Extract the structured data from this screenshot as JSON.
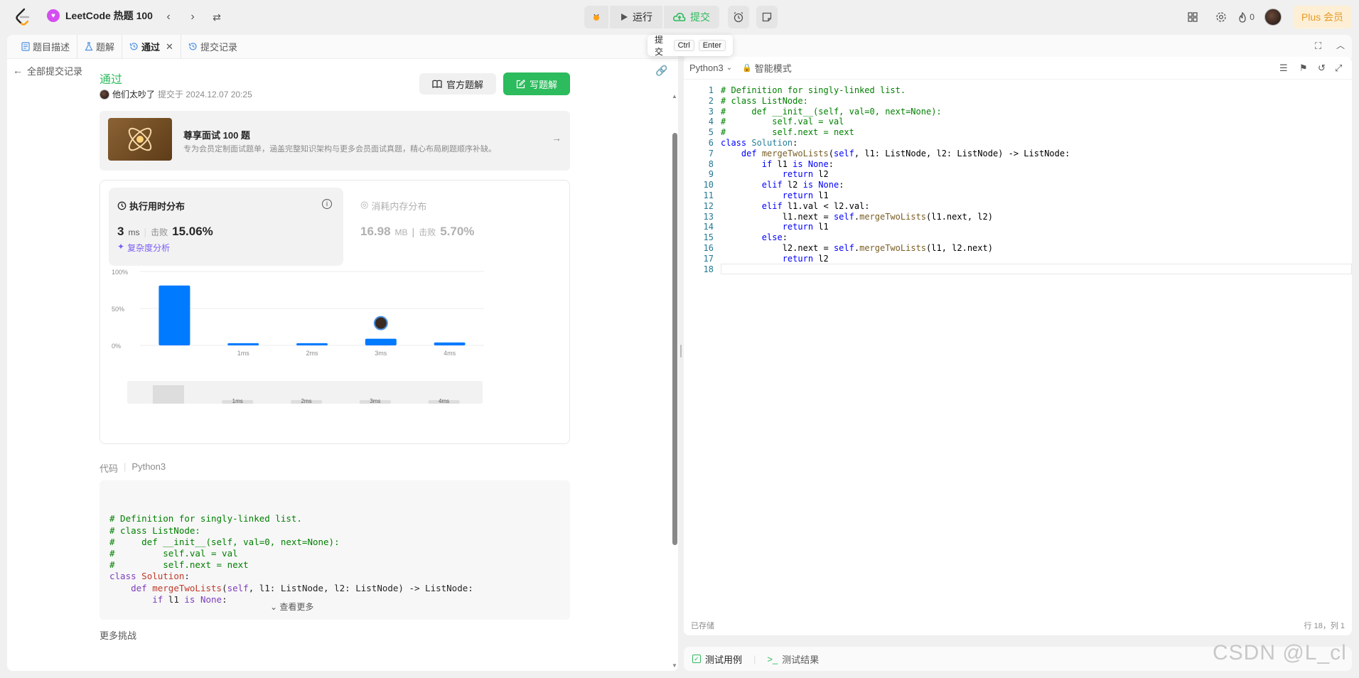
{
  "topbar": {
    "brand": "LeetCode 热题 100",
    "run": "运行",
    "submit": "提交",
    "coins": "0",
    "plus": "Plus 会员"
  },
  "tooltip": {
    "label": "提交",
    "k1": "Ctrl",
    "k2": "Enter"
  },
  "tabs": [
    {
      "label": "题目描述"
    },
    {
      "label": "题解"
    },
    {
      "label": "通过"
    },
    {
      "label": "提交记录"
    }
  ],
  "subheader": {
    "back": "全部提交记录"
  },
  "result": {
    "status": "通过",
    "user": "他们太吵了",
    "submitted": "提交于 2024.12.07 20:25",
    "official": "官方题解",
    "write": "写题解"
  },
  "promo": {
    "title": "尊享面试 100 题",
    "desc": "专为会员定制面试题单，涵盖完整知识架构与更多会员面试真题，精心布局刷题顺序补缺。"
  },
  "runtime": {
    "title": "执行用时分布",
    "value": "3",
    "unit": "ms",
    "beat_label": "击败",
    "beat": "15.06%",
    "complexity": "复杂度分析"
  },
  "memory": {
    "title": "消耗内存分布",
    "value": "16.98",
    "unit": "MB",
    "beat_label": "击败",
    "beat": "5.70%"
  },
  "chart_data": {
    "type": "bar",
    "categories": [
      "",
      "1ms",
      "2ms",
      "3ms",
      "4ms"
    ],
    "values": [
      81,
      3,
      3,
      9,
      4
    ],
    "ylim": [
      0,
      100
    ],
    "yticks": [
      "0%",
      "50%",
      "100%"
    ],
    "highlight": "3ms",
    "color": "#007aff"
  },
  "minimap": {
    "labels": [
      "1ms",
      "2ms",
      "3ms",
      "4ms"
    ]
  },
  "code_section": {
    "label": "代码",
    "lang": "Python3",
    "more": "查看更多",
    "challenge": "更多挑战"
  },
  "editor": {
    "lang": "Python3",
    "mode": "智能模式",
    "saved": "已存储",
    "cursor": "行 18，列 1"
  },
  "code_lines": [
    "# Definition for singly-linked list.",
    "# class ListNode:",
    "#     def __init__(self, val=0, next=None):",
    "#         self.val = val",
    "#         self.next = next",
    "class Solution:",
    "    def mergeTwoLists(self, l1: ListNode, l2: ListNode) -> ListNode:",
    "        if l1 is None:",
    "            return l2",
    "        elif l2 is None:",
    "            return l1",
    "        elif l1.val < l2.val:",
    "            l1.next = self.mergeTwoLists(l1.next, l2)",
    "            return l1",
    "        else:",
    "            l2.next = self.mergeTwoLists(l1, l2.next)",
    "            return l2",
    ""
  ],
  "bottombar": {
    "testcase": "测试用例",
    "result": "测试结果"
  },
  "watermark": "CSDN @L_cl"
}
